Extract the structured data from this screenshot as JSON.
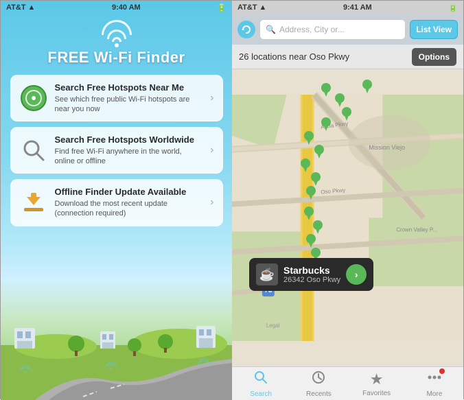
{
  "left": {
    "statusBar": {
      "carrier": "AT&T",
      "signal": "●●●●○",
      "wifi": "wifi",
      "time": "9:40 AM",
      "battery": "battery"
    },
    "appTitle": "FREE Wi-Fi Finder",
    "menuItems": [
      {
        "id": "near-me",
        "title": "Search Free Hotspots Near Me",
        "subtitle": "See which free public Wi-Fi hotspots are near you now",
        "iconType": "radar"
      },
      {
        "id": "worldwide",
        "title": "Search Free Hotspots Worldwide",
        "subtitle": "Find free Wi-Fi anywhere in the world, online or offline",
        "iconType": "magnifier"
      },
      {
        "id": "offline",
        "title": "Offline Finder Update Available",
        "subtitle": "Download the most recent update (connection required)",
        "iconType": "download"
      }
    ]
  },
  "right": {
    "statusBar": {
      "carrier": "AT&T",
      "signal": "●●●●○",
      "wifi": "wifi",
      "time": "9:41 AM",
      "battery": "battery"
    },
    "searchPlaceholder": "Address, City or...",
    "listViewLabel": "List View",
    "locationText": "26 locations near Oso Pkwy",
    "optionsLabel": "Options",
    "callout": {
      "name": "Starbucks",
      "address": "26342 Oso Pkwy",
      "icon": "☕"
    },
    "mapLabel": "Legal",
    "tabs": [
      {
        "id": "search",
        "label": "Search",
        "icon": "🔍",
        "active": true
      },
      {
        "id": "recents",
        "label": "Recents",
        "icon": "🕐",
        "active": false
      },
      {
        "id": "favorites",
        "label": "Favorites",
        "icon": "★",
        "active": false
      },
      {
        "id": "more",
        "label": "More",
        "icon": "•••",
        "active": false
      }
    ]
  }
}
